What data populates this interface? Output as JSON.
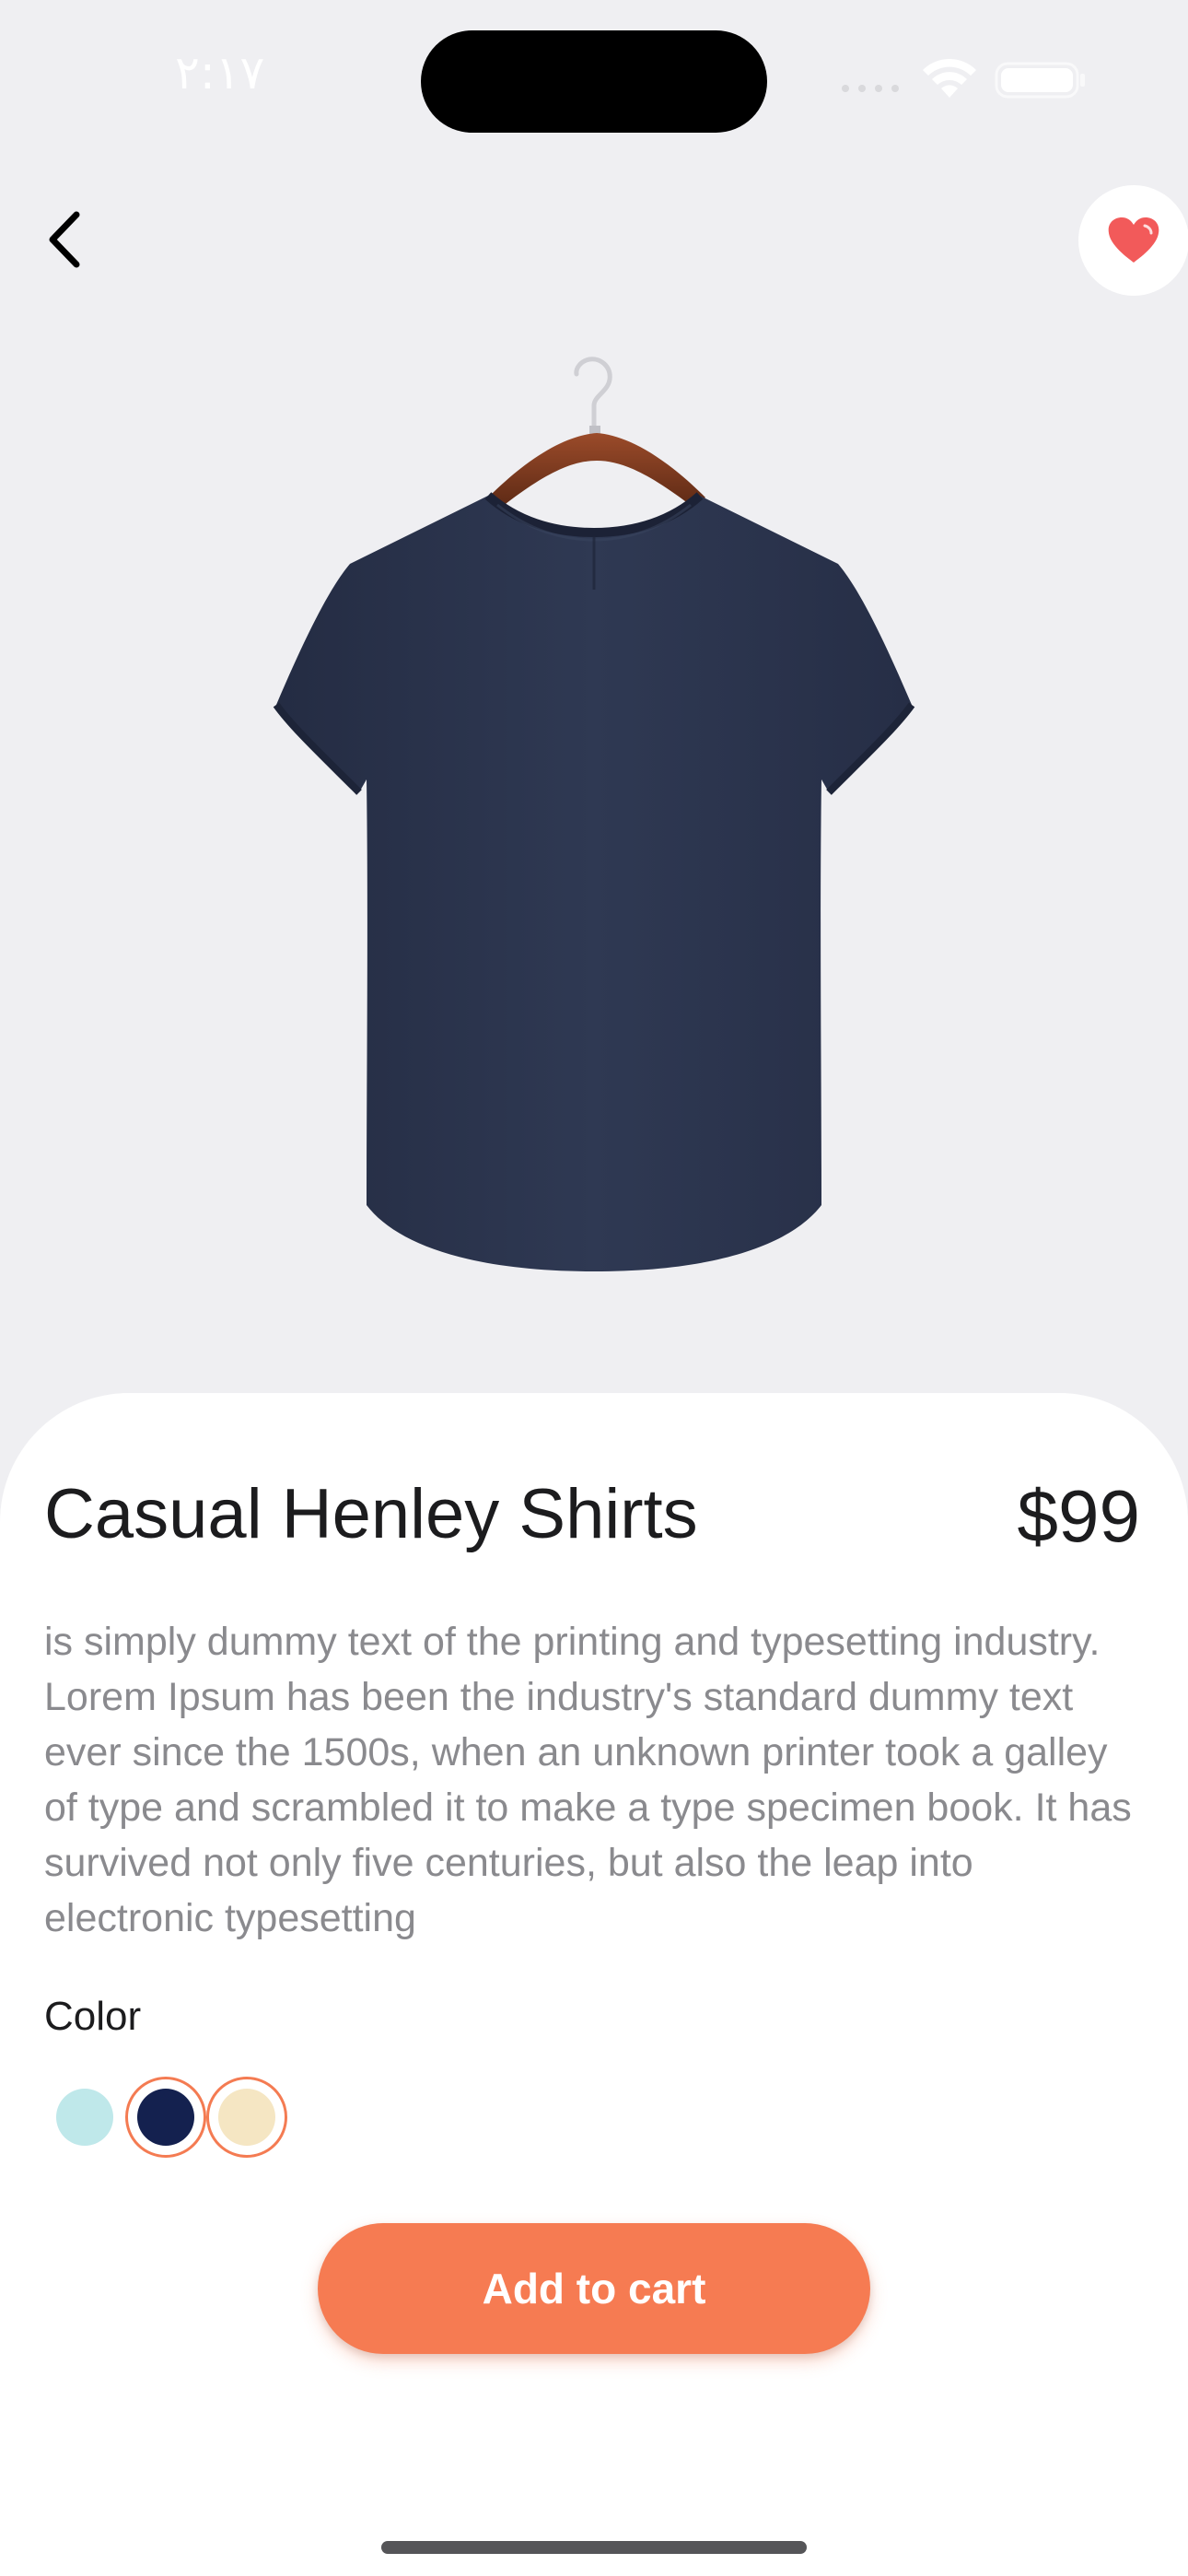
{
  "status_bar": {
    "time": "٢:١٧"
  },
  "product": {
    "title": "Casual Henley Shirts",
    "price": "$99",
    "description": "is simply dummy text of the printing and typesetting industry. Lorem Ipsum has been the industry's standard dummy text ever since the 1500s, when an unknown printer took a galley of type and scrambled it to make a type specimen book. It has survived not only five centuries, but also the leap into electronic typesetting",
    "color_label": "Color",
    "colors": [
      {
        "name": "light-blue",
        "hex": "#bfe8ea",
        "selected": false
      },
      {
        "name": "navy",
        "hex": "#14214f",
        "selected": true
      },
      {
        "name": "cream",
        "hex": "#f5e6c3",
        "selected": true
      }
    ]
  },
  "actions": {
    "add_to_cart_label": "Add to cart"
  },
  "theme": {
    "accent": "#f67b52",
    "favorite_heart": "#f25a5a",
    "background": "#efeff2",
    "shirt": "#2b3550"
  },
  "icons": {
    "back": "chevron-left-icon",
    "favorite": "heart-icon"
  }
}
